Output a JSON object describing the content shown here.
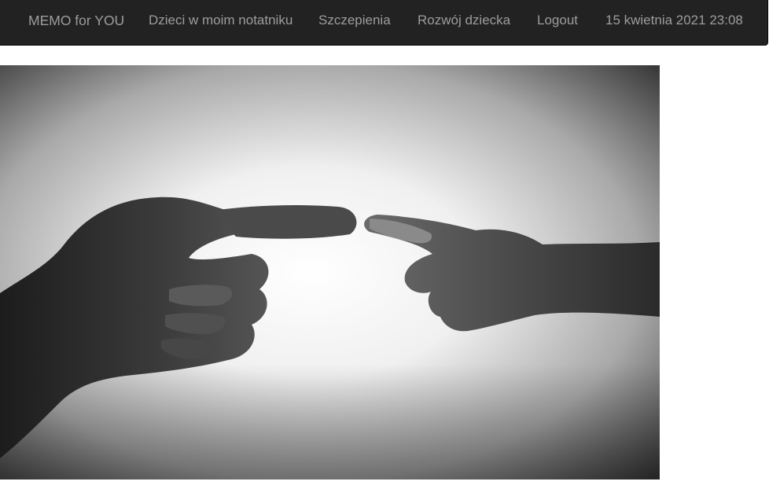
{
  "navbar": {
    "brand": "MEMO for YOU",
    "items": [
      {
        "label": "Dzieci w moim notatniku"
      },
      {
        "label": "Szczepienia"
      },
      {
        "label": "Rozwój dziecka"
      },
      {
        "label": "Logout"
      }
    ],
    "datetime": "15 kwietnia 2021 23:08"
  },
  "hero": {
    "image_subject": "adult-hand-touching-child-hand-photo"
  },
  "colors": {
    "navbar_bg": "#222222",
    "nav_text": "#9d9d9d",
    "page_bg": "#ffffff"
  }
}
